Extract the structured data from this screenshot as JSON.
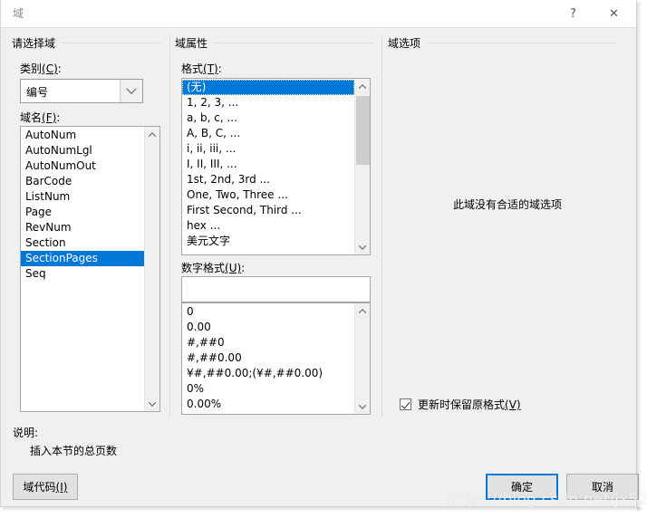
{
  "window": {
    "title": "域",
    "help_label": "?",
    "close_label": "✕"
  },
  "groups": {
    "select_field": "请选择域",
    "field_properties": "域属性",
    "field_options": "域选项"
  },
  "category": {
    "label_main": "类别",
    "label_accel": "(C)",
    "label_suffix": ":",
    "value": "编号",
    "arrow_icon": "chevron-down-icon"
  },
  "field_names": {
    "label_main": "域名",
    "label_accel": "(F)",
    "label_suffix": ":",
    "selected": "SectionPages",
    "items": [
      "AutoNum",
      "AutoNumLgl",
      "AutoNumOut",
      "BarCode",
      "ListNum",
      "Page",
      "RevNum",
      "Section",
      "SectionPages",
      "Seq"
    ]
  },
  "format": {
    "label_main": "格式",
    "label_accel": "(T)",
    "label_suffix": ":",
    "selected": "(无)",
    "items": [
      "(无)",
      "1, 2, 3, ...",
      "a, b, c, ...",
      "A, B, C, ...",
      "i, ii, iii, ...",
      "I, II, III, ...",
      "1st, 2nd, 3rd ...",
      "One, Two, Three ...",
      "First Second, Third ...",
      "hex ...",
      "美元文字"
    ]
  },
  "numeric_format": {
    "label_main": "数字格式",
    "label_accel": "(U)",
    "label_suffix": ":",
    "input_value": "",
    "input_placeholder": "",
    "items": [
      "0",
      "0.00",
      "#,##0",
      "#,##0.00",
      "¥#,##0.00;(¥#,##0.00)",
      "0%",
      "0.00%"
    ]
  },
  "field_options_pane": {
    "empty_message": "此域没有合适的域选项"
  },
  "preserve_formatting": {
    "checked": true,
    "label_main": "更新时保留原格式",
    "label_accel": "(V)",
    "checkbox_icon": "checkmark-icon"
  },
  "description": {
    "label": "说明:",
    "text": "插入本节的总页数"
  },
  "buttons": {
    "field_code_main": "域代码",
    "field_code_accel": "(I)",
    "ok": "确定",
    "cancel": "取消"
  },
  "watermark": {
    "text": "https://blog.csdn.net/jx520"
  },
  "colors": {
    "accent": "#0078d7",
    "dialog_bg": "#f0f0f0",
    "button_face": "#e1e1e1",
    "scroll_thumb": "#cdcdcd"
  }
}
